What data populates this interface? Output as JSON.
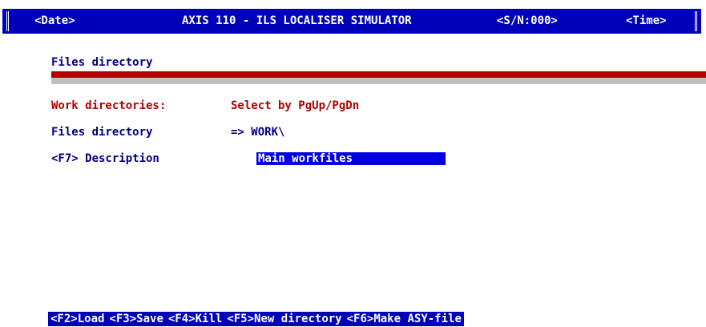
{
  "header": {
    "date": "<Date>",
    "title": "AXIS 110 - ILS LOCALISER SIMULATOR",
    "serial": "<S/N:000>",
    "time": "<Time>"
  },
  "section_title": "Files directory",
  "rows": {
    "work_dirs_label": "Work directories:",
    "work_dirs_value": "Select by PgUp/PgDn",
    "files_dir_label": "Files directory",
    "files_dir_value": "=> WORK\\",
    "description_label": "<F7> Description",
    "description_value": "Main workfiles"
  },
  "function_keys": [
    "<F2>Load",
    "<F3>Save",
    "<F4>Kill",
    "<F5>New directory",
    "<F6>Make ASY-file"
  ],
  "colors": {
    "title_bar": "#0000b8",
    "label_red": "#b00000",
    "label_navy": "#000080",
    "field_highlight": "#0000e0",
    "separator_grey": "#c0c0c0"
  }
}
